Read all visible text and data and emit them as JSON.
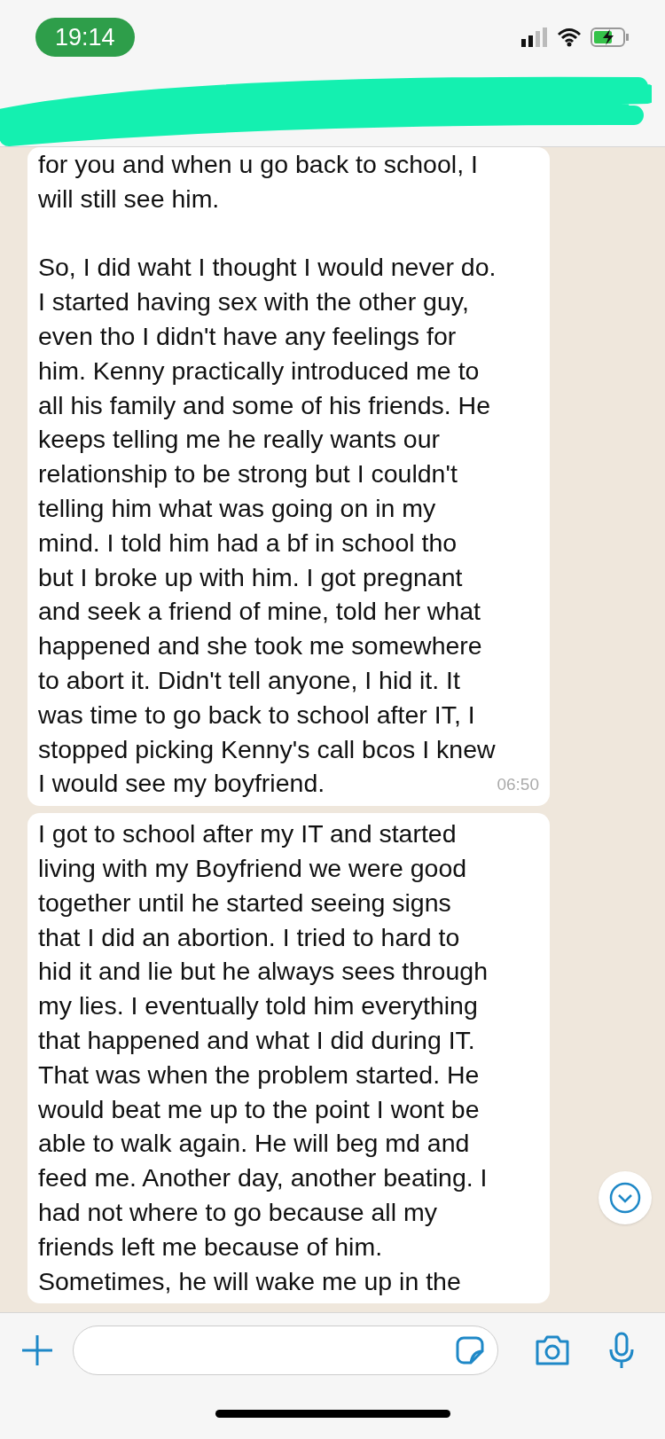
{
  "status_bar": {
    "time": "19:14"
  },
  "messages": [
    {
      "text": "for you and when u go back to school, I\nwill still see him.\n\nSo, I did waht I thought I would never do.\nI started having sex with the other guy,\neven tho I didn't have any feelings for\nhim. Kenny practically introduced me to\nall his family and some of his friends. He\nkeeps telling me he really wants our\nrelationship to be strong but I couldn't\ntelling him what was going on in my\nmind. I told him had a bf in school tho\nbut I broke up with him. I got pregnant\nand seek a friend of mine, told her what\nhappened and she took me somewhere\nto abort it. Didn't tell anyone, I hid it. It\nwas time to go back to school after IT, I\nstopped picking Kenny's call bcos I knew\nI would see my boyfriend.",
      "time": "06:50"
    },
    {
      "text": "I got to school after my IT and started\nliving with my Boyfriend we were good\ntogether until he started seeing signs\nthat I did an abortion. I tried to hard to\nhid it and lie but he always sees through\nmy lies. I eventually told him everything\nthat happened and what I did during IT.\nThat was when the problem started. He\nwould beat me up to the point I wont be\nable to walk again. He will beg md and\nfeed me. Another day, another beating. I\nhad not where to go because all my\nfriends left me because of him.\nSometimes, he will wake me up in the"
    }
  ]
}
